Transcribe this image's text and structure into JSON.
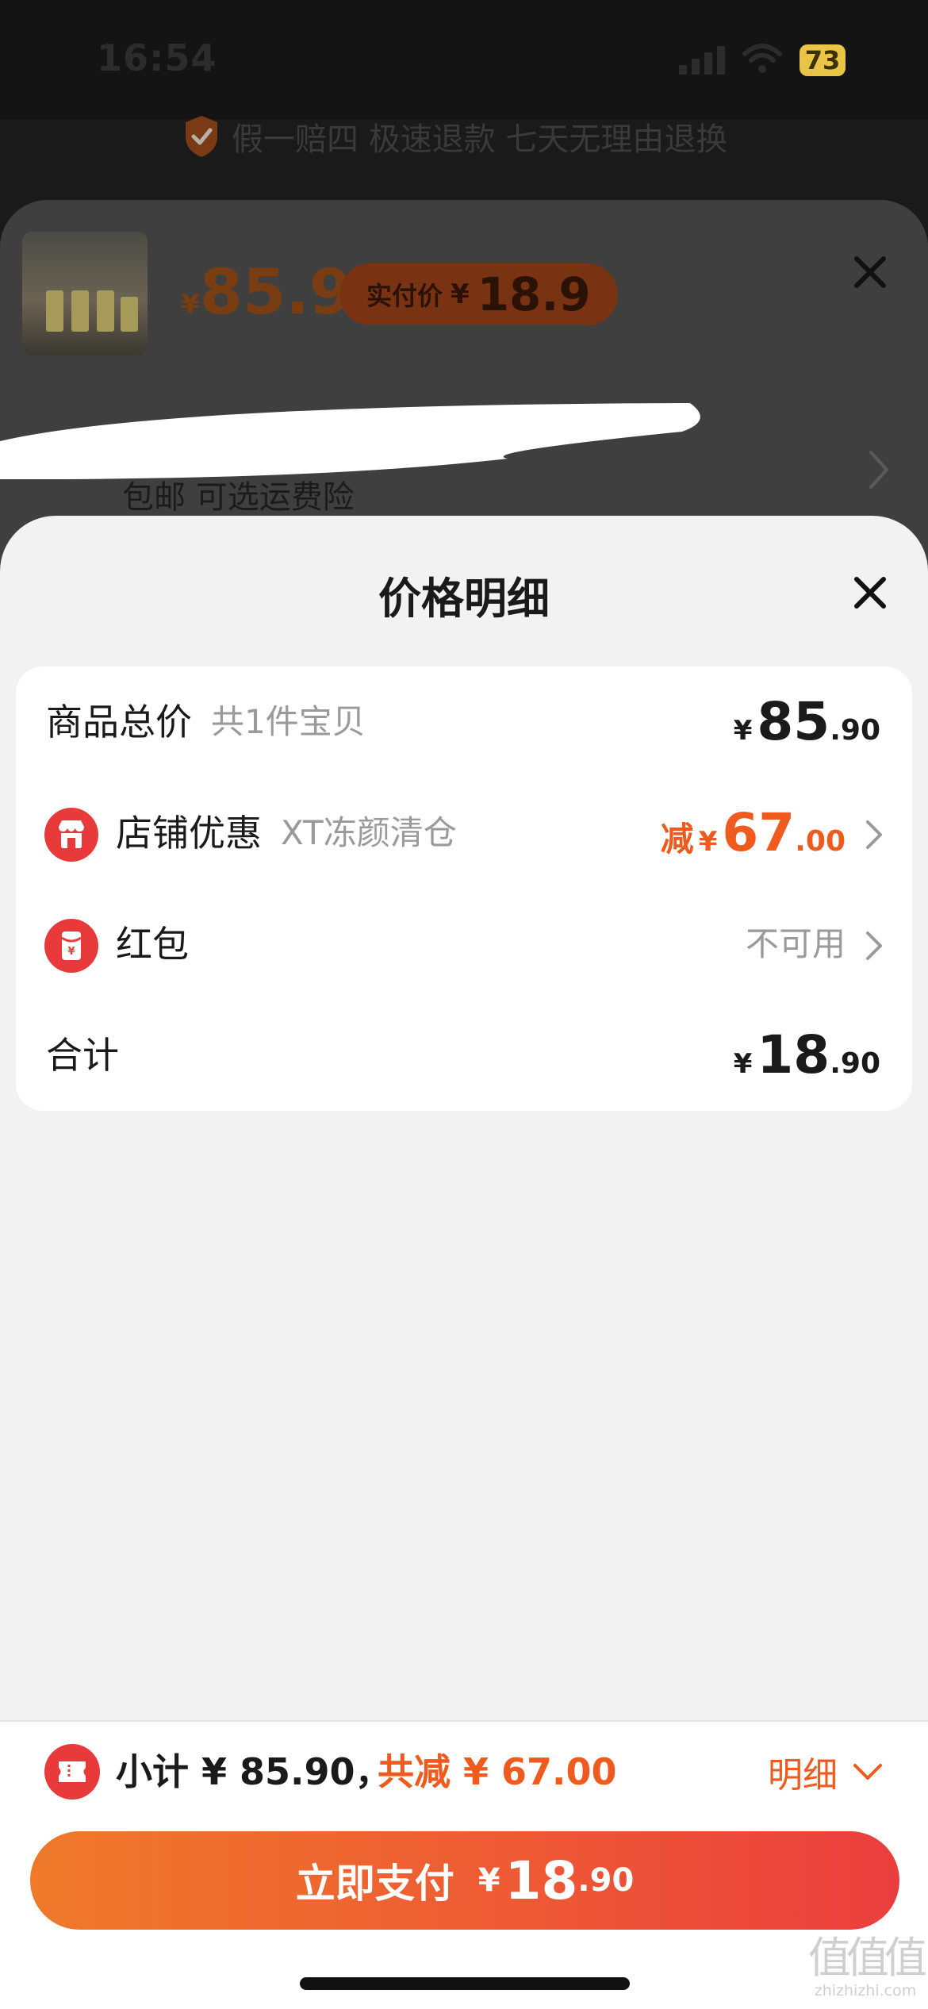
{
  "status_bar": {
    "time": "16:54",
    "battery": "73",
    "icons": [
      "signal-icon",
      "wifi-icon",
      "battery-icon"
    ]
  },
  "guarantee": {
    "icon": "shield-check-icon",
    "text": "假一赔四 极速退款 七天无理由退换"
  },
  "product": {
    "thumbnail_icon": "product-thumbnail",
    "price_symbol": "¥",
    "price": "85.9",
    "paid_label": "实付价",
    "paid_symbol": "¥",
    "paid_price": "18.9",
    "shipping_text": "包邮 可选运费险"
  },
  "price_detail": {
    "title": "价格明细",
    "rows": [
      {
        "label": "商品总价",
        "sub": "共1件宝贝",
        "symbol": "¥",
        "int": "85",
        "dec": ".90"
      },
      {
        "icon": "shop-icon",
        "label": "店铺优惠",
        "sub": "XT冻颜清仓",
        "prefix": "减",
        "symbol": "¥",
        "int": "67",
        "dec": ".00"
      },
      {
        "icon": "red-packet-icon",
        "label": "红包",
        "value": "不可用"
      },
      {
        "label": "合计",
        "symbol": "¥",
        "int": "18",
        "dec": ".90"
      }
    ]
  },
  "bottom_bar": {
    "icon": "coupon-icon",
    "subtotal": "小计 ¥ 85.90，",
    "total_reduction": "共减 ¥ 67.00",
    "detail_label": "明细",
    "pay_label": "立即支付",
    "pay_symbol": "¥",
    "pay_int": "18",
    "pay_dec": ".90"
  },
  "watermark": {
    "mark": "值值值",
    "url": "zhizhizhi.com"
  },
  "colors": {
    "accent_orange": "#ef5a1e",
    "icon_red": "#e83a3a",
    "pay_gradient_start": "#ef7a2a",
    "pay_gradient_end": "#ea3e3e"
  }
}
